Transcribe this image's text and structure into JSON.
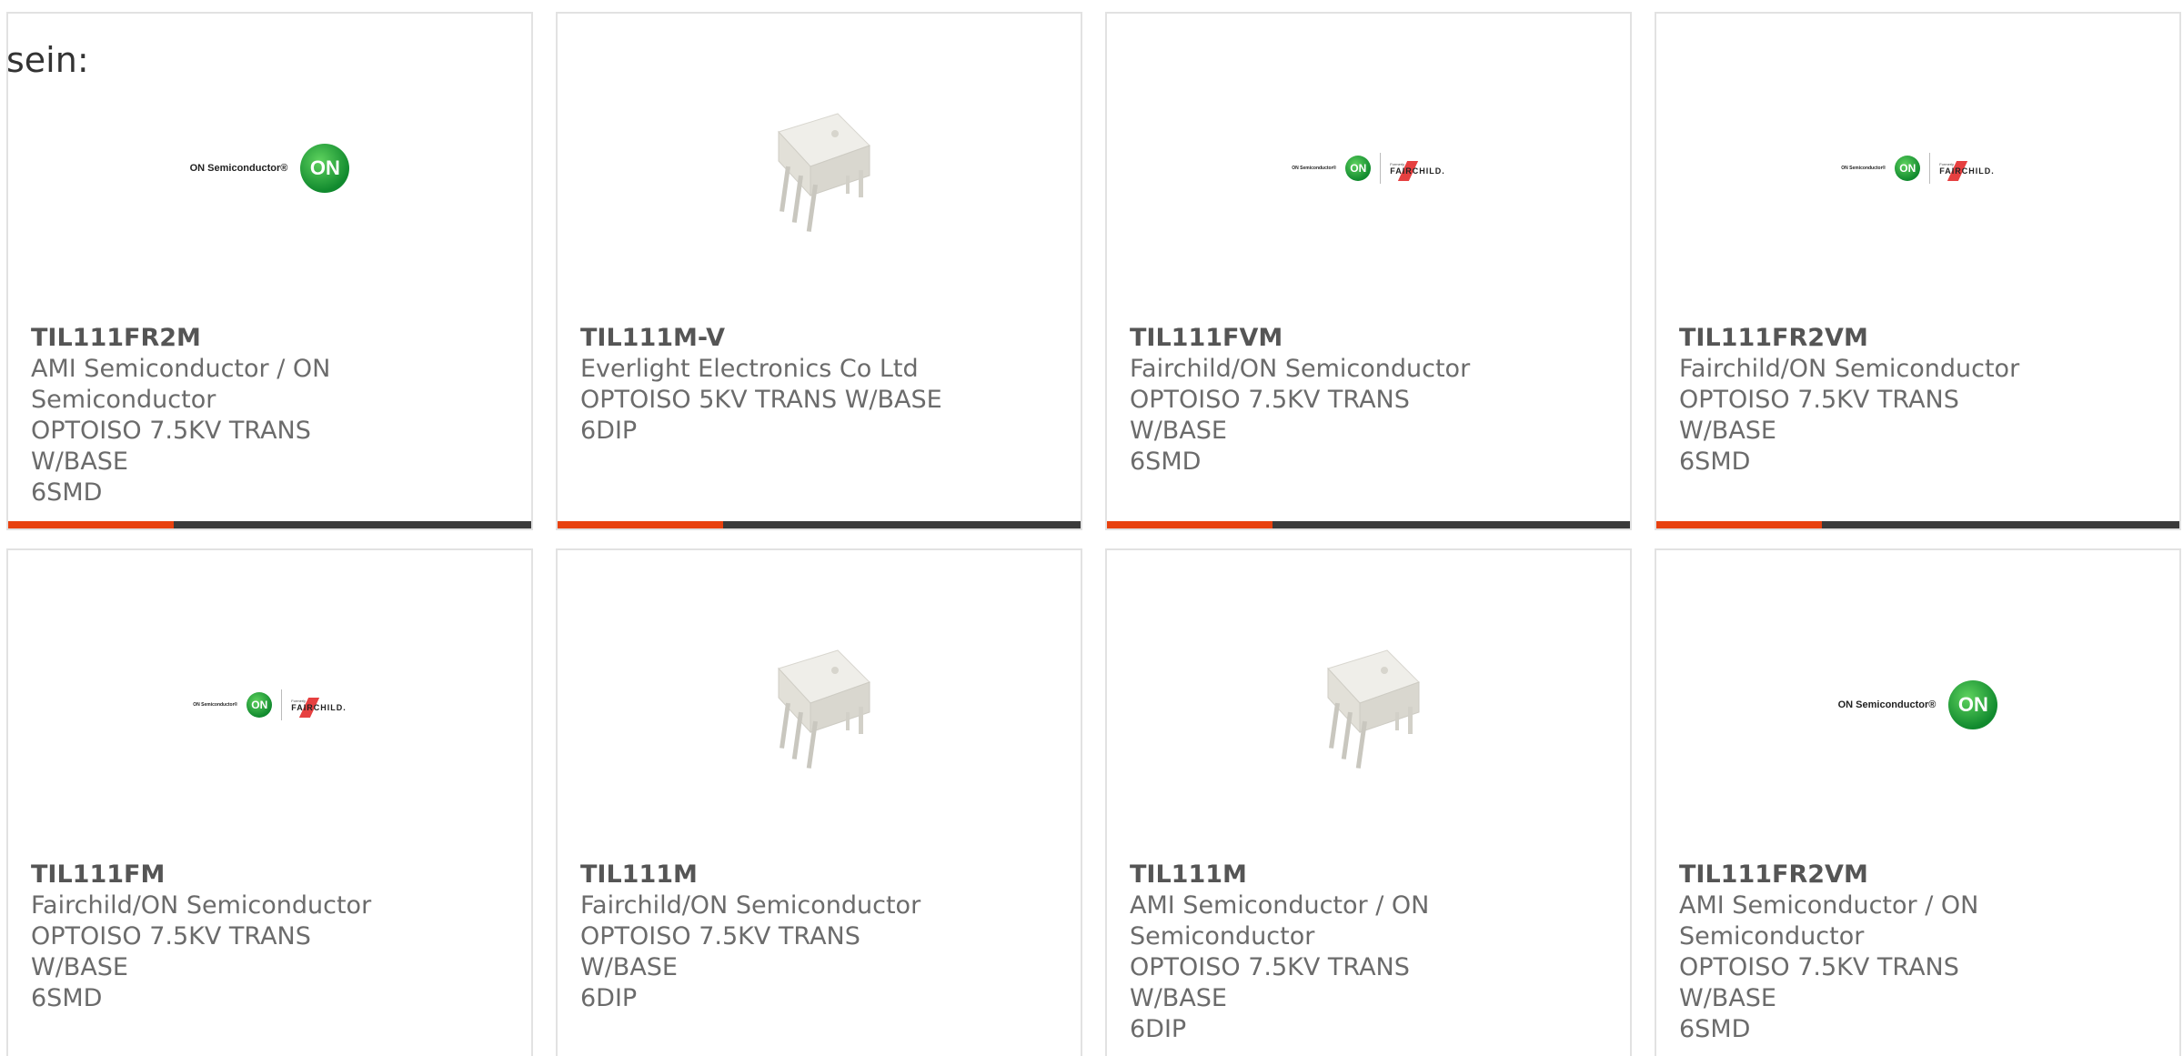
{
  "intro_text": "sein:",
  "products": [
    {
      "part": "TIL111FR2M",
      "manufacturer": "AMI Semiconductor / ON Semiconductor",
      "description": "OPTOISO 7.5KV TRANS W/BASE",
      "package": "6SMD",
      "image": "on-semiconductor-logo"
    },
    {
      "part": "TIL111M-V",
      "manufacturer": "Everlight Electronics Co Ltd",
      "description": "OPTOISO 5KV TRANS W/BASE",
      "package": "6DIP",
      "image": "dip6-chip-photo"
    },
    {
      "part": "TIL111FVM",
      "manufacturer": "Fairchild/ON Semiconductor",
      "description": "OPTOISO 7.5KV TRANS W/BASE",
      "package": "6SMD",
      "image": "on-fairchild-logo"
    },
    {
      "part": "TIL111FR2VM",
      "manufacturer": "Fairchild/ON Semiconductor",
      "description": "OPTOISO 7.5KV TRANS W/BASE",
      "package": "6SMD",
      "image": "on-fairchild-logo"
    },
    {
      "part": "TIL111FM",
      "manufacturer": "Fairchild/ON Semiconductor",
      "description": "OPTOISO 7.5KV TRANS W/BASE",
      "package": "6SMD",
      "image": "on-fairchild-logo"
    },
    {
      "part": "TIL111M",
      "manufacturer": "Fairchild/ON Semiconductor",
      "description": "OPTOISO 7.5KV TRANS W/BASE",
      "package": "6DIP",
      "image": "dip6-chip-photo"
    },
    {
      "part": "TIL111M",
      "manufacturer": "AMI Semiconductor / ON Semiconductor",
      "description": "OPTOISO 7.5KV TRANS W/BASE",
      "package": "6DIP",
      "image": "dip6-chip-photo"
    },
    {
      "part": "TIL111FR2VM",
      "manufacturer": "AMI Semiconductor / ON Semiconductor",
      "description": "OPTOISO 7.5KV TRANS W/BASE",
      "package": "6SMD",
      "image": "on-semiconductor-logo"
    }
  ],
  "logo_text": {
    "on_wordmark": "ON Semiconductor®",
    "on_badge": "ON",
    "fair_formerly": "Formerly",
    "fair_name": "FAIRCHILD."
  },
  "colors": {
    "accent": "#e8410f",
    "bar": "#3a3a3a",
    "border": "#e2e2e2",
    "on_green": "#1a9a35"
  }
}
